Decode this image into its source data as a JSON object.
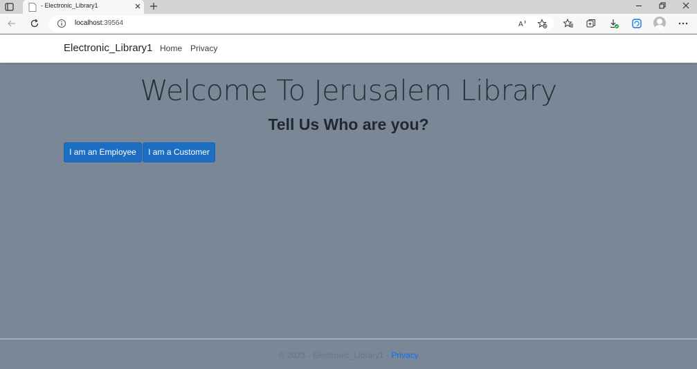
{
  "browser": {
    "tab_title": "- Electronic_Library1",
    "url_host": "localhost",
    "url_port": ":39564"
  },
  "navbar": {
    "brand": "Electronic_Library1",
    "links": [
      {
        "label": "Home"
      },
      {
        "label": "Privacy"
      }
    ]
  },
  "main": {
    "heading": "Welcome To Jerusalem Library",
    "subheading": "Tell Us Who are you?",
    "buttons": [
      {
        "label": "I am an Employee"
      },
      {
        "label": "I am a Customer"
      }
    ]
  },
  "footer": {
    "copyright": "© 2023 - Electronic_Library1 -",
    "privacy_link": "Privacy"
  },
  "colors": {
    "page_background": "#7a8797",
    "primary_button": "#1b6ec2",
    "link": "#0d6efd"
  },
  "icons": [
    "tab-actions-icon",
    "page-icon",
    "close-icon",
    "plus-icon",
    "minimize-icon",
    "restore-icon",
    "back-icon",
    "refresh-icon",
    "info-icon",
    "read-aloud-icon",
    "add-favorite-icon",
    "favorites-icon",
    "collections-icon",
    "downloads-icon",
    "browser-essentials-icon",
    "profile-avatar",
    "more-icon"
  ]
}
